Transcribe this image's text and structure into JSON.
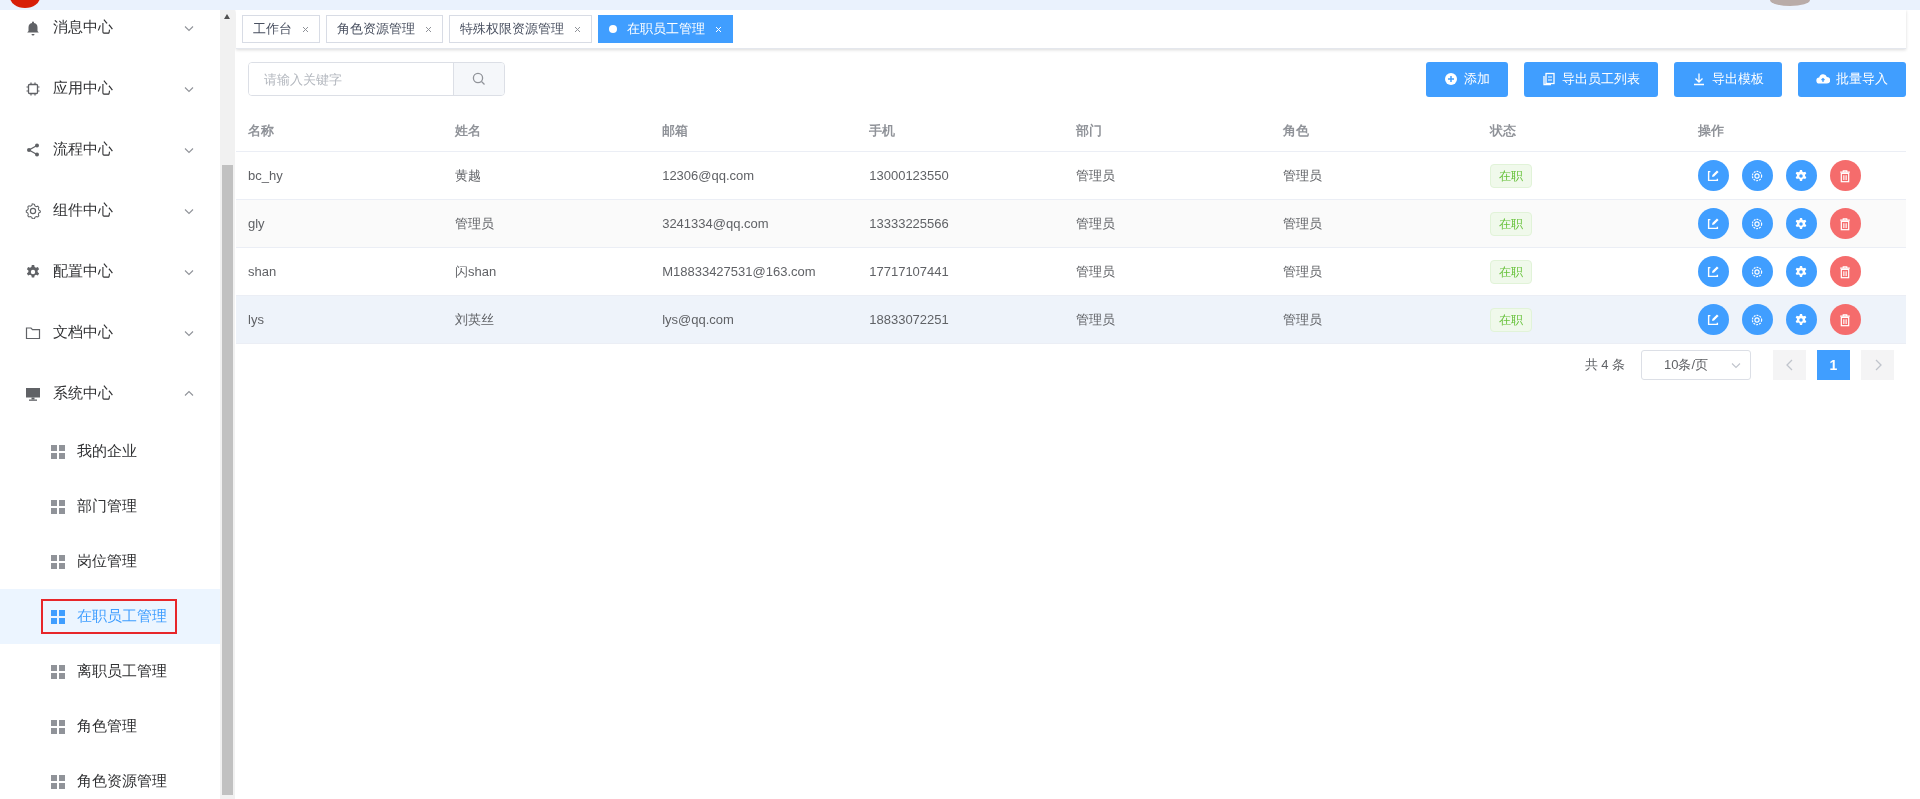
{
  "sidebar": {
    "items": [
      {
        "label": "消息中心",
        "expanded": false
      },
      {
        "label": "应用中心",
        "expanded": false
      },
      {
        "label": "流程中心",
        "expanded": false
      },
      {
        "label": "组件中心",
        "expanded": false
      },
      {
        "label": "配置中心",
        "expanded": false
      },
      {
        "label": "文档中心",
        "expanded": false
      },
      {
        "label": "系统中心",
        "expanded": true,
        "children": [
          {
            "label": "我的企业",
            "selected": false,
            "outlined": false
          },
          {
            "label": "部门管理",
            "selected": false,
            "outlined": false
          },
          {
            "label": "岗位管理",
            "selected": false,
            "outlined": false
          },
          {
            "label": "在职员工管理",
            "selected": true,
            "outlined": true
          },
          {
            "label": "离职员工管理",
            "selected": false,
            "outlined": false
          },
          {
            "label": "角色管理",
            "selected": false,
            "outlined": false
          },
          {
            "label": "角色资源管理",
            "selected": false,
            "outlined": false
          }
        ]
      }
    ]
  },
  "tabs": [
    {
      "label": "工作台",
      "selected": false
    },
    {
      "label": "角色资源管理",
      "selected": false
    },
    {
      "label": "特殊权限资源管理",
      "selected": false
    },
    {
      "label": "在职员工管理",
      "selected": true
    }
  ],
  "search": {
    "placeholder": "请输入关键字"
  },
  "buttons": [
    "添加",
    "导出员工列表",
    "导出模板",
    "批量导入"
  ],
  "table": {
    "columns": [
      "名称",
      "姓名",
      "邮箱",
      "手机",
      "部门",
      "角色",
      "状态",
      "操作"
    ],
    "rows": [
      {
        "cells": [
          "bc_hy",
          "黄越",
          "12306@qq.com",
          "13000123550",
          "管理员",
          "管理员"
        ],
        "status": "在职",
        "hovered": false
      },
      {
        "cells": [
          "gly",
          "管理员",
          "3241334@qq.com",
          "13333225566",
          "管理员",
          "管理员"
        ],
        "status": "在职",
        "hovered": false
      },
      {
        "cells": [
          "shan",
          "闪shan",
          "M18833427531@163.com",
          "17717107441",
          "管理员",
          "管理员"
        ],
        "status": "在职",
        "hovered": false
      },
      {
        "cells": [
          "lys",
          "刘英丝",
          "lys@qq.com",
          "18833072251",
          "管理员",
          "管理员"
        ],
        "status": "在职",
        "hovered": true
      }
    ]
  },
  "pagination": {
    "total": "共 4 条",
    "page_size": "10条/页",
    "pages": [
      {
        "label": "1",
        "selected": true
      }
    ]
  }
}
